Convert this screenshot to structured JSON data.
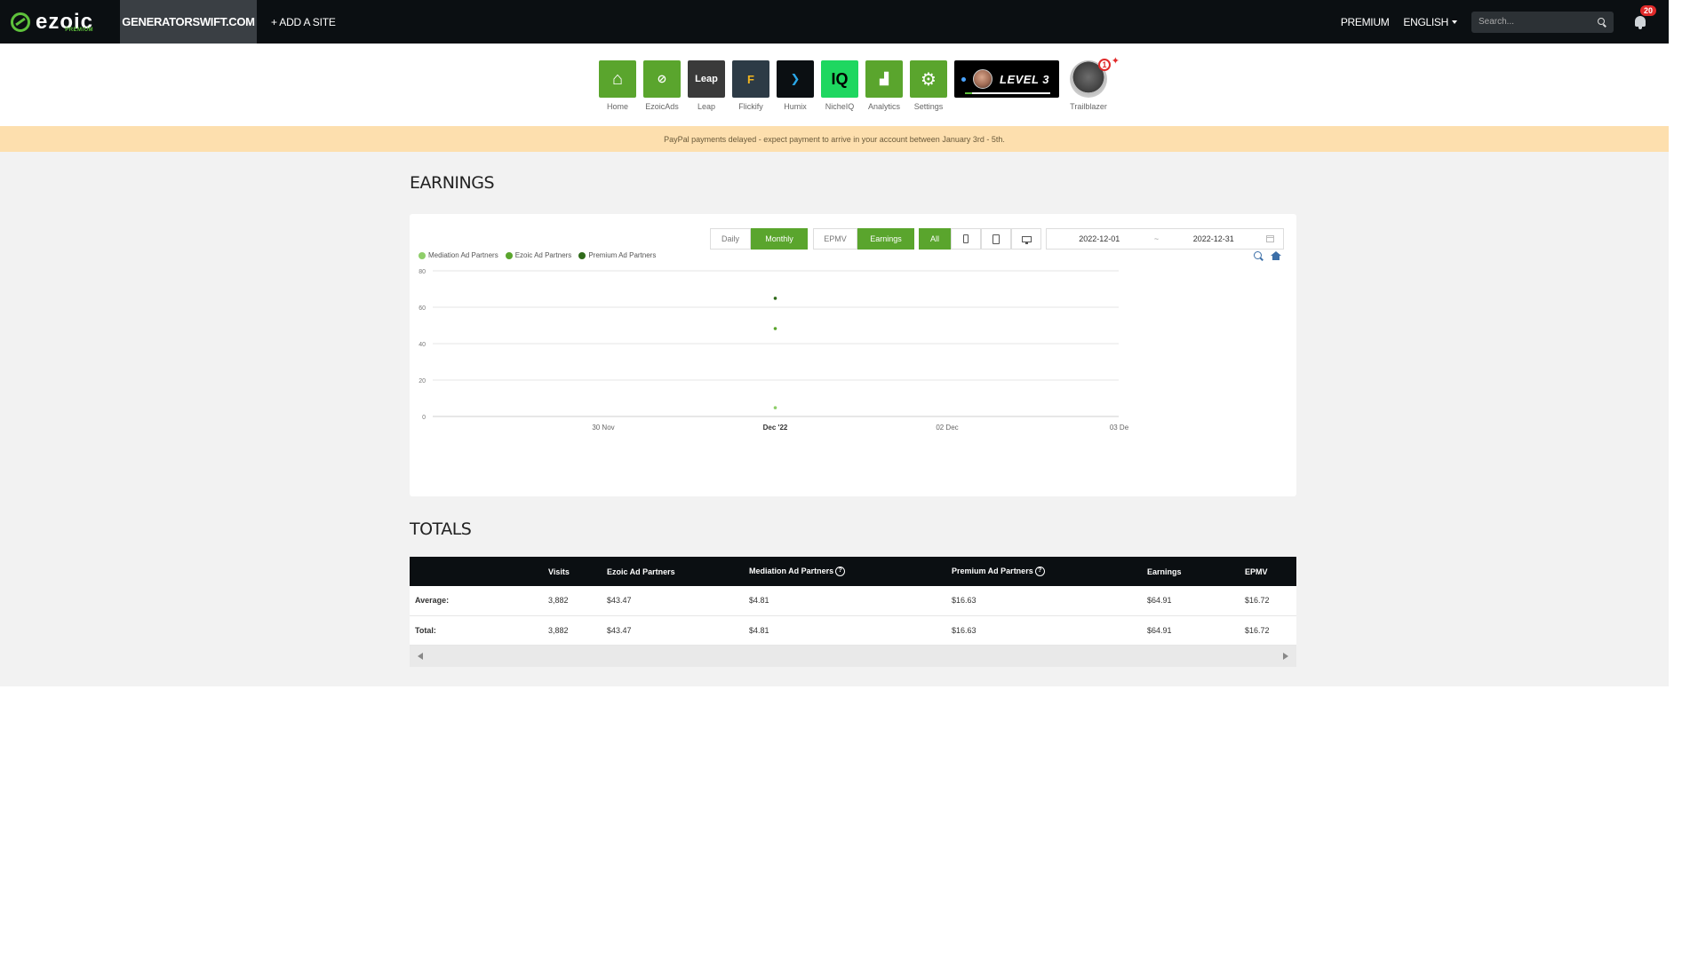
{
  "topbar": {
    "logo_text": "ezoic",
    "logo_sub": "PREMIUM",
    "site": "GENERATORSWIFT.COM",
    "add_site": "+ ADD A SITE",
    "premium": "PREMIUM",
    "language": "ENGLISH",
    "search_placeholder": "Search...",
    "notification_count": "20"
  },
  "apps": [
    {
      "label": "Home",
      "color": "#5aa52d",
      "glyph": "⌂"
    },
    {
      "label": "EzoicAds",
      "color": "#5aa52d",
      "glyph": "⊘"
    },
    {
      "label": "Leap",
      "color": "#3a3a3a",
      "glyph": "Leap"
    },
    {
      "label": "Flickify",
      "color": "#2d3b46",
      "glyph": "F"
    },
    {
      "label": "Humix",
      "color": "#0b0f12",
      "glyph": "❯"
    },
    {
      "label": "NicheIQ",
      "color": "#1ed760",
      "glyph": "IQ"
    },
    {
      "label": "Analytics",
      "color": "#5aa52d",
      "glyph": "▟"
    },
    {
      "label": "Settings",
      "color": "#5aa52d",
      "glyph": "⚙"
    }
  ],
  "level": {
    "text": "LEVEL 3"
  },
  "trailblazer": {
    "label": "Trailblazer",
    "badge": "1"
  },
  "notice": "PayPal payments delayed - expect payment to arrive in your account between January 3rd - 5th.",
  "earnings": {
    "title": "EARNINGS",
    "period_buttons": [
      "Daily",
      "Monthly"
    ],
    "metric_buttons": [
      "EPMV",
      "Earnings"
    ],
    "device_all": "All",
    "date_start": "2022-12-01",
    "date_sep": "~",
    "date_end": "2022-12-31"
  },
  "chart_data": {
    "type": "scatter",
    "x_ticks": [
      "30 Nov",
      "Dec '22",
      "02 Dec",
      "03 De"
    ],
    "y_ticks": [
      0,
      20,
      40,
      60,
      80
    ],
    "ylim": [
      0,
      80
    ],
    "legend_placement": "top-left",
    "grid": true,
    "series": [
      {
        "name": "Mediation Ad Partners",
        "color": "#8fce6a",
        "points": [
          {
            "x": "Dec '22",
            "y": 4.81
          }
        ]
      },
      {
        "name": "Ezoic Ad Partners",
        "color": "#5aa52d",
        "points": [
          {
            "x": "Dec '22",
            "y": 48.28
          }
        ]
      },
      {
        "name": "Premium Ad Partners",
        "color": "#2f6a1a",
        "points": [
          {
            "x": "Dec '22",
            "y": 64.91
          }
        ]
      }
    ]
  },
  "totals": {
    "title": "TOTALS",
    "headers": [
      "",
      "Visits",
      "Ezoic Ad Partners",
      "Mediation Ad Partners",
      "Premium Ad Partners",
      "Earnings",
      "EPMV"
    ],
    "rows": [
      [
        "Average:",
        "3,882",
        "$43.47",
        "$4.81",
        "$16.63",
        "$64.91",
        "$16.72"
      ],
      [
        "Total:",
        "3,882",
        "$43.47",
        "$4.81",
        "$16.63",
        "$64.91",
        "$16.72"
      ]
    ]
  }
}
